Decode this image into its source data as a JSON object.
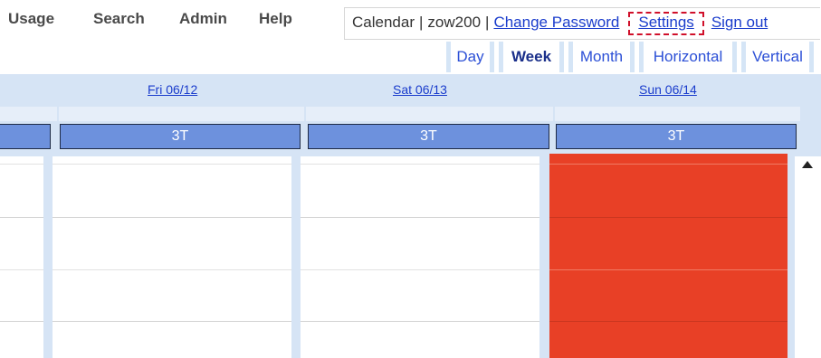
{
  "menu": {
    "items": [
      "Usage",
      "Search",
      "Admin",
      "Help"
    ]
  },
  "user_bar": {
    "calendar": "Calendar",
    "user": "zow200",
    "separator": "|",
    "change_password": "Change Password",
    "settings": "Settings",
    "sign_out": "Sign out"
  },
  "view_tabs": {
    "items": [
      "Day",
      "Week",
      "Month",
      "Horizontal",
      "Vertical"
    ],
    "active": "Week"
  },
  "columns": {
    "dates": [
      "Fri 06/12",
      "Sat 06/13",
      "Sun 06/14"
    ],
    "resource_label": "3T"
  },
  "colors": {
    "link": "#1a3ccc",
    "header_band": "#d6e4f5",
    "resource_bar": "#6d91dd",
    "booked": "#e84026",
    "settings_highlight": "#d0102a"
  },
  "icons": {
    "scroll_up": "triangle-up"
  }
}
